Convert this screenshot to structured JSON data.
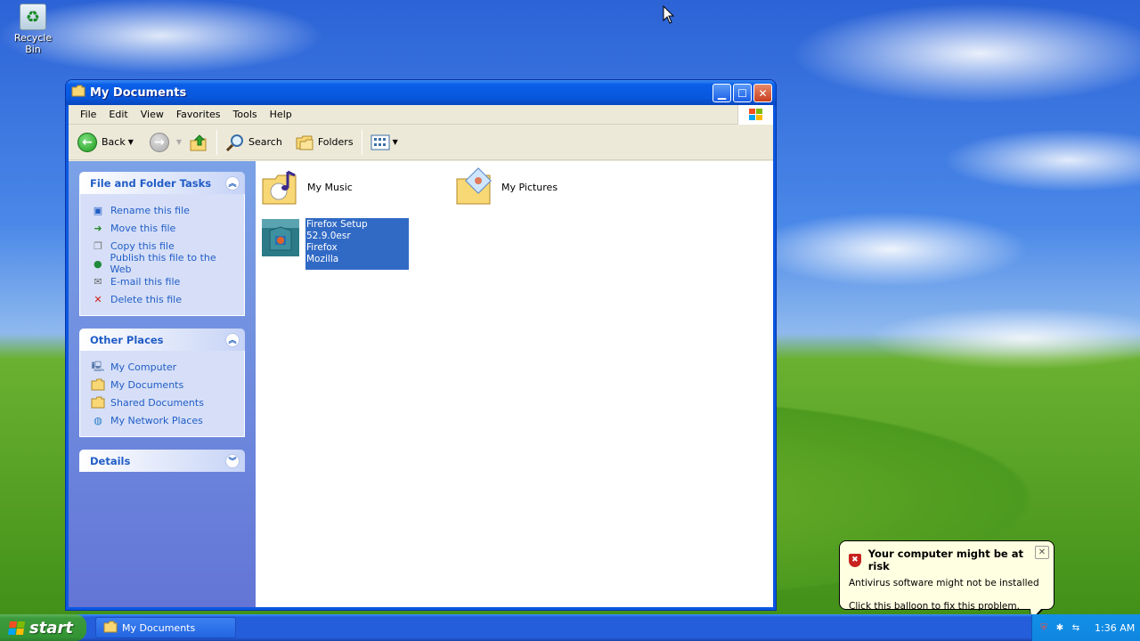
{
  "desktop": {
    "icons": [
      {
        "label": "Recycle Bin",
        "icon": "recycle-bin-icon"
      }
    ]
  },
  "window": {
    "title": "My Documents",
    "controls": {
      "minimize": "minimize-icon",
      "maximize": "maximize-icon",
      "close": "close-icon"
    },
    "menu": [
      "File",
      "Edit",
      "View",
      "Favorites",
      "Tools",
      "Help"
    ],
    "toolbar": {
      "back_label": "Back",
      "search_label": "Search",
      "folders_label": "Folders"
    },
    "tasks_panel": {
      "title": "File and Folder Tasks",
      "items": [
        {
          "label": "Rename this file",
          "icon": "rename-icon"
        },
        {
          "label": "Move this file",
          "icon": "move-icon"
        },
        {
          "label": "Copy this file",
          "icon": "copy-icon"
        },
        {
          "label": "Publish this file to the Web",
          "icon": "web-publish-icon"
        },
        {
          "label": "E-mail this file",
          "icon": "email-icon"
        },
        {
          "label": "Delete this file",
          "icon": "delete-icon"
        }
      ]
    },
    "other_places": {
      "title": "Other Places",
      "items": [
        {
          "label": "My Computer",
          "icon": "computer-icon"
        },
        {
          "label": "My Documents",
          "icon": "folder-icon"
        },
        {
          "label": "Shared Documents",
          "icon": "folder-icon"
        },
        {
          "label": "My Network Places",
          "icon": "network-icon"
        }
      ]
    },
    "details": {
      "title": "Details"
    },
    "files": [
      {
        "name": "My Music",
        "icon": "music-folder-icon"
      },
      {
        "name": "My Pictures",
        "icon": "pictures-folder-icon"
      },
      {
        "name": "Firefox Setup 52.9.0esr",
        "line2": "Firefox",
        "line3": "Mozilla",
        "icon": "installer-icon",
        "selected": true
      }
    ]
  },
  "taskbar": {
    "start_label": "start",
    "task_label": "My Documents",
    "clock": "1:36 AM"
  },
  "balloon": {
    "title": "Your computer might be at risk",
    "line1": "Antivirus software might not be installed",
    "line2": "Click this balloon to fix this problem."
  },
  "colors": {
    "selection": "#316ac5",
    "task_link": "#215dc6",
    "taskbar": "#245edb",
    "start": "#339433",
    "balloon_bg": "#ffffe1"
  }
}
